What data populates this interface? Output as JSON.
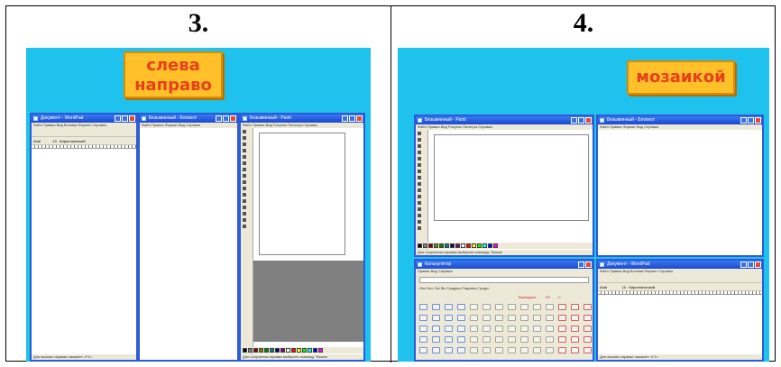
{
  "sections": [
    {
      "number": "3.",
      "label_line1": "слева",
      "label_line2": "направо"
    },
    {
      "number": "4.",
      "label": "мозаикой"
    }
  ],
  "left_windows": {
    "wordpad": {
      "title": "Документ - WordPad",
      "menu": "Файл  Правка  Вид  Вставка  Формат  Справка",
      "font": "Arial",
      "size": "10",
      "charset": "Кириллический",
      "status": "Для вызова справки нажмите <F1>"
    },
    "notepad": {
      "title": "Безымянный - Блокнот",
      "menu": "Файл  Правка  Формат  Вид  Справка"
    },
    "paint": {
      "title": "Безымянный - Paint",
      "menu": "Файл  Правка  Вид  Рисунок  Палитра  Справка",
      "status": "Для получения справки выберите команду \"Вызов"
    }
  },
  "right_windows": {
    "paint": {
      "title": "Безымянный - Paint",
      "menu": "Файл  Правка  Вид  Рисунок  Палитра  Справка",
      "status": "Для получения справки выберите команду \"Вызов"
    },
    "notepad": {
      "title": "Безымянный - Блокнот",
      "menu": "Файл  Правка  Формат  Вид  Справка"
    },
    "calc": {
      "title": "Калькулятор",
      "menu": "Правка  Вид  Справка",
      "modes": "Hex  Dec  Oct  Bin   Градусы   Радианы   Грады",
      "backspace": "Backspace",
      "ce": "CE",
      "c": "C"
    },
    "wordpad": {
      "title": "Документ - WordPad",
      "menu": "Файл  Правка  Вид  Вставка  Формат  Справка",
      "font": "Arial",
      "size": "10",
      "charset": "Кириллический",
      "status": "Для вызова справки нажмите <F1>"
    }
  },
  "colors": {
    "background": "#1fc2ec",
    "tag_fill": "#ffc02a",
    "tag_text": "#e8401a",
    "title_bar": "#2356dc"
  }
}
